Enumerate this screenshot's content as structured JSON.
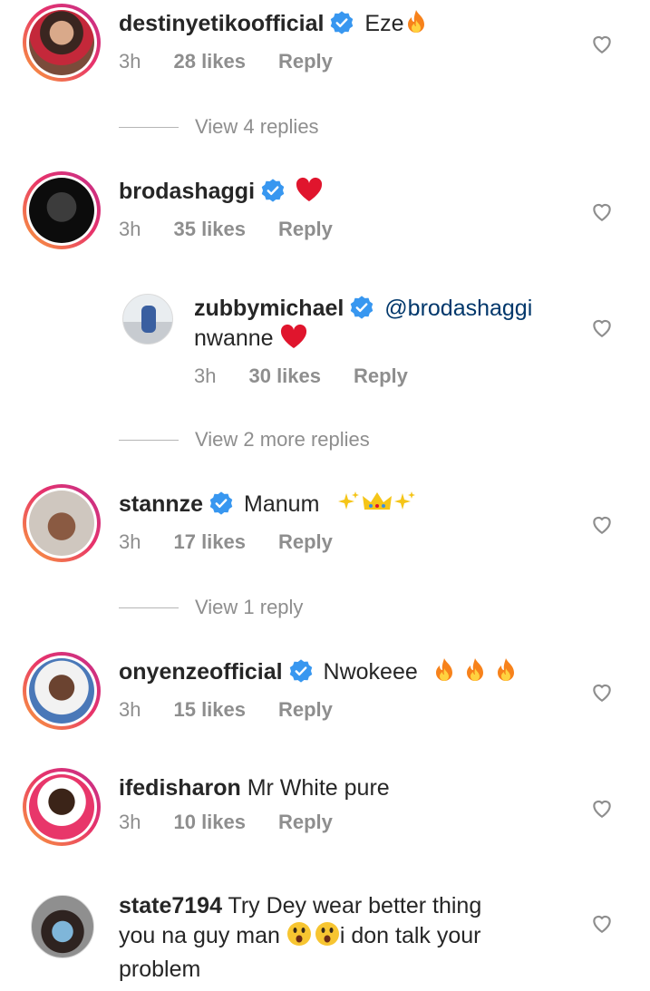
{
  "comments": [
    {
      "username": "destinyetikoofficial",
      "verified": true,
      "text": "Eze",
      "emoji": [
        "fire"
      ],
      "time": "3h",
      "likes": "28 likes",
      "reply": "Reply"
    },
    {
      "username": "brodashaggi",
      "verified": true,
      "text": "",
      "emoji": [
        "red-heart"
      ],
      "time": "3h",
      "likes": "35 likes",
      "reply": "Reply"
    },
    {
      "username": "zubbymichael",
      "verified": true,
      "mention": "@brodashaggi",
      "text": "nwanne",
      "emoji": [
        "red-heart"
      ],
      "time": "3h",
      "likes": "30 likes",
      "reply": "Reply"
    },
    {
      "username": "stannze",
      "verified": true,
      "text": "Manum",
      "emoji": [
        "sparkles",
        "crown",
        "sparkles"
      ],
      "time": "3h",
      "likes": "17 likes",
      "reply": "Reply"
    },
    {
      "username": "onyenzeofficial",
      "verified": true,
      "text": "Nwokeee",
      "emoji": [
        "fire",
        "fire",
        "fire"
      ],
      "time": "3h",
      "likes": "15 likes",
      "reply": "Reply"
    },
    {
      "username": "ifedisharon",
      "verified": false,
      "text": "Mr White pure",
      "time": "3h",
      "likes": "10 likes",
      "reply": "Reply"
    },
    {
      "username": "state7194",
      "verified": false,
      "text_line1": "Try Dey wear  better thing",
      "text_line2a": "you na guy man",
      "text_line2b": "i don talk your",
      "text_line3": "problem",
      "emoji": [
        "astonished-face",
        "astonished-face"
      ]
    }
  ],
  "view_replies": [
    "View 4 replies",
    "View 2 more replies",
    "View 1 reply"
  ],
  "colors": {
    "text": "#262626",
    "muted": "#8e8e8e",
    "verified": "#3897f0",
    "mention": "#00376b",
    "ring_start": "#f9a13a",
    "ring_end": "#c22f8c"
  }
}
